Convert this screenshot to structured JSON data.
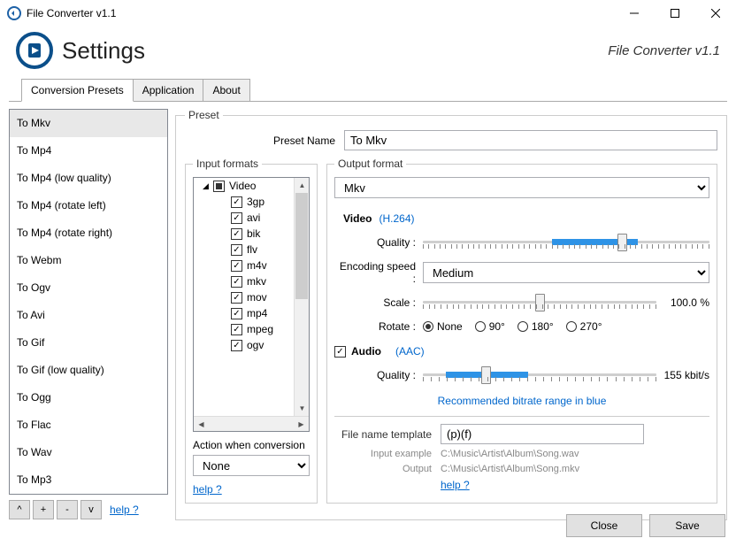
{
  "window": {
    "title": "File Converter v1.1",
    "version_label": "File Converter v1.1"
  },
  "header": {
    "title": "Settings"
  },
  "tabs": {
    "conversion_presets": "Conversion Presets",
    "application": "Application",
    "about": "About"
  },
  "presets": {
    "items": [
      "To Mkv",
      "To Mp4",
      "To Mp4 (low quality)",
      "To Mp4 (rotate left)",
      "To Mp4 (rotate right)",
      "To Webm",
      "To Ogv",
      "To Avi",
      "To Gif",
      "To Gif (low quality)",
      "To Ogg",
      "To Flac",
      "To Wav",
      "To Mp3"
    ],
    "selected_index": 0,
    "btn_up": "^",
    "btn_add": "+",
    "btn_remove": "-",
    "btn_down": "v",
    "help": "help ?"
  },
  "preset_detail": {
    "legend": "Preset",
    "name_label": "Preset Name",
    "name_value": "To Mkv"
  },
  "input_formats": {
    "legend": "Input formats",
    "group": "Video",
    "items": [
      "3gp",
      "avi",
      "bik",
      "flv",
      "m4v",
      "mkv",
      "mov",
      "mp4",
      "mpeg",
      "ogv"
    ],
    "action_label": "Action when conversion",
    "action_value": "None",
    "help": "help ?"
  },
  "output": {
    "legend": "Output format",
    "format_value": "Mkv",
    "video": {
      "label": "Video",
      "codec": "(H.264)",
      "quality_label": "Quality :",
      "encoding_label": "Encoding speed :",
      "encoding_value": "Medium",
      "scale_label": "Scale :",
      "scale_value": "100.0 %",
      "rotate_label": "Rotate :",
      "rotate_options": [
        "None",
        "90°",
        "180°",
        "270°"
      ],
      "rotate_selected": 0
    },
    "audio": {
      "label": "Audio",
      "codec": "(AAC)",
      "enabled": true,
      "quality_label": "Quality :",
      "quality_value": "155 kbit/s",
      "note": "Recommended bitrate range in blue"
    },
    "filename": {
      "label": "File name template",
      "value": "(p)(f)",
      "input_example_label": "Input example",
      "input_example_value": "C:\\Music\\Artist\\Album\\Song.wav",
      "output_label": "Output",
      "output_value": "C:\\Music\\Artist\\Album\\Song.mkv",
      "help": "help ?"
    }
  },
  "footer": {
    "close": "Close",
    "save": "Save"
  }
}
